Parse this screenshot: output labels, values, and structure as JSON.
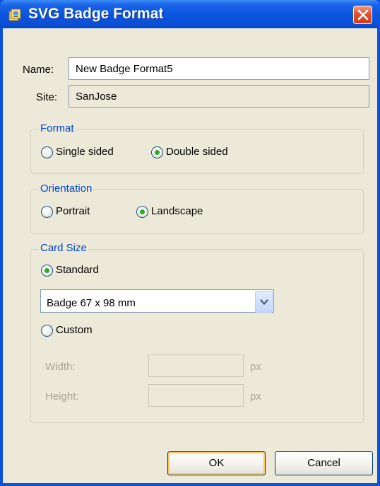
{
  "window": {
    "title": "SVG Badge Format",
    "title_icon": "badge-format-icon",
    "close_icon": "close-icon"
  },
  "fields": {
    "name_label": "Name:",
    "name_value": "New Badge Format5",
    "site_label": "Site:",
    "site_value": "SanJose"
  },
  "format": {
    "legend": "Format",
    "options": [
      {
        "label": "Single sided",
        "checked": false
      },
      {
        "label": "Double sided",
        "checked": true
      }
    ]
  },
  "orientation": {
    "legend": "Orientation",
    "options": [
      {
        "label": "Portrait",
        "checked": false
      },
      {
        "label": "Landscape",
        "checked": true
      }
    ]
  },
  "card_size": {
    "legend": "Card Size",
    "standard_label": "Standard",
    "standard_checked": true,
    "dropdown_value": "Badge 67 x 98 mm",
    "custom_label": "Custom",
    "custom_checked": false,
    "width_label": "Width:",
    "height_label": "Height:",
    "unit": "px",
    "width_value": "",
    "height_value": ""
  },
  "buttons": {
    "ok": "OK",
    "cancel": "Cancel"
  },
  "colors": {
    "titlebar": "#0a55df",
    "legend_text": "#0046d5",
    "radio_dot": "#2dab2d",
    "dialog_bg": "#ece9d8"
  }
}
